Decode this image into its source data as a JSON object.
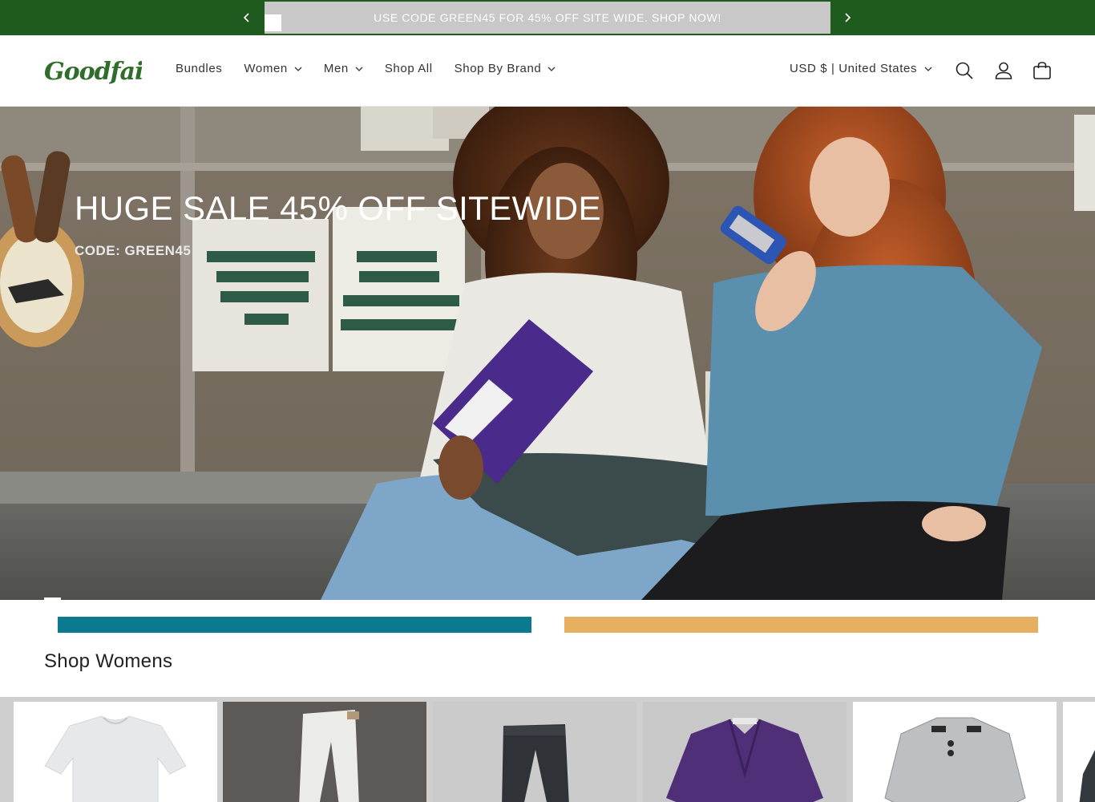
{
  "announcement": {
    "text": "USE CODE GREEN45 FOR 45% OFF SITE WIDE. SHOP NOW!",
    "prev_icon": "chevron-left-icon",
    "next_icon": "chevron-right-icon"
  },
  "header": {
    "logo_text": "Goodfair",
    "nav": [
      {
        "label": "Bundles",
        "has_dropdown": false
      },
      {
        "label": "Women",
        "has_dropdown": true
      },
      {
        "label": "Men",
        "has_dropdown": true
      },
      {
        "label": "Shop All",
        "has_dropdown": false
      },
      {
        "label": "Shop By Brand",
        "has_dropdown": true
      }
    ],
    "currency": "USD $ | United States",
    "icons": [
      "search-icon",
      "account-icon",
      "cart-icon"
    ]
  },
  "hero": {
    "title": "HUGE SALE 45% OFF SITEWIDE",
    "subtitle": "CODE: GREEN45"
  },
  "section": {
    "title": "Shop Womens"
  },
  "colors": {
    "announcement_bg": "#1f5a1f",
    "brand_green": "#2f6e2a",
    "strip_teal": "#0b7a8f",
    "strip_gold": "#e6b060"
  }
}
